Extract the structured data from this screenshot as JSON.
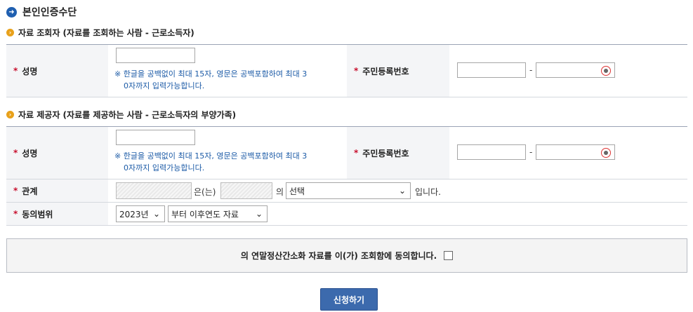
{
  "page_title": "본인인증수단",
  "sections": {
    "querier": {
      "title": "자료 조회자 (자료를 조회하는 사람 - 근로소득자)"
    },
    "provider": {
      "title": "자료 제공자 (자료를 제공하는 사람 - 근로소득자의 부양가족)"
    }
  },
  "labels": {
    "name": "성명",
    "rrn": "주민등록번호",
    "relation": "관계",
    "consent_range": "동의범위",
    "required_mark": "*"
  },
  "name_note_line1": "※ 한글을 공백없이 최대 15자, 영문은 공백포함하여 최대 3",
  "name_note_line2": "0자까지 입력가능합니다.",
  "rrn_separator": "-",
  "relation": {
    "suffix_eun": "은(는)",
    "suffix_ui": "의",
    "select_value": "선택",
    "suffix_end": "입니다."
  },
  "consent": {
    "year_value": "2023년",
    "range_value": "부터 이후연도 자료"
  },
  "agree_text": "의 연말정산간소화 자료를 이(가) 조회함에 동의합니다.",
  "submit_label": "신청하기",
  "icons": {
    "title": "arrow-circle-icon",
    "section": "bullet-icon",
    "eye": "eye-icon"
  },
  "colors": {
    "accent": "#1f5fb0",
    "required": "#c8102e",
    "note": "#1b5aa6",
    "button": "#3c6aad"
  }
}
